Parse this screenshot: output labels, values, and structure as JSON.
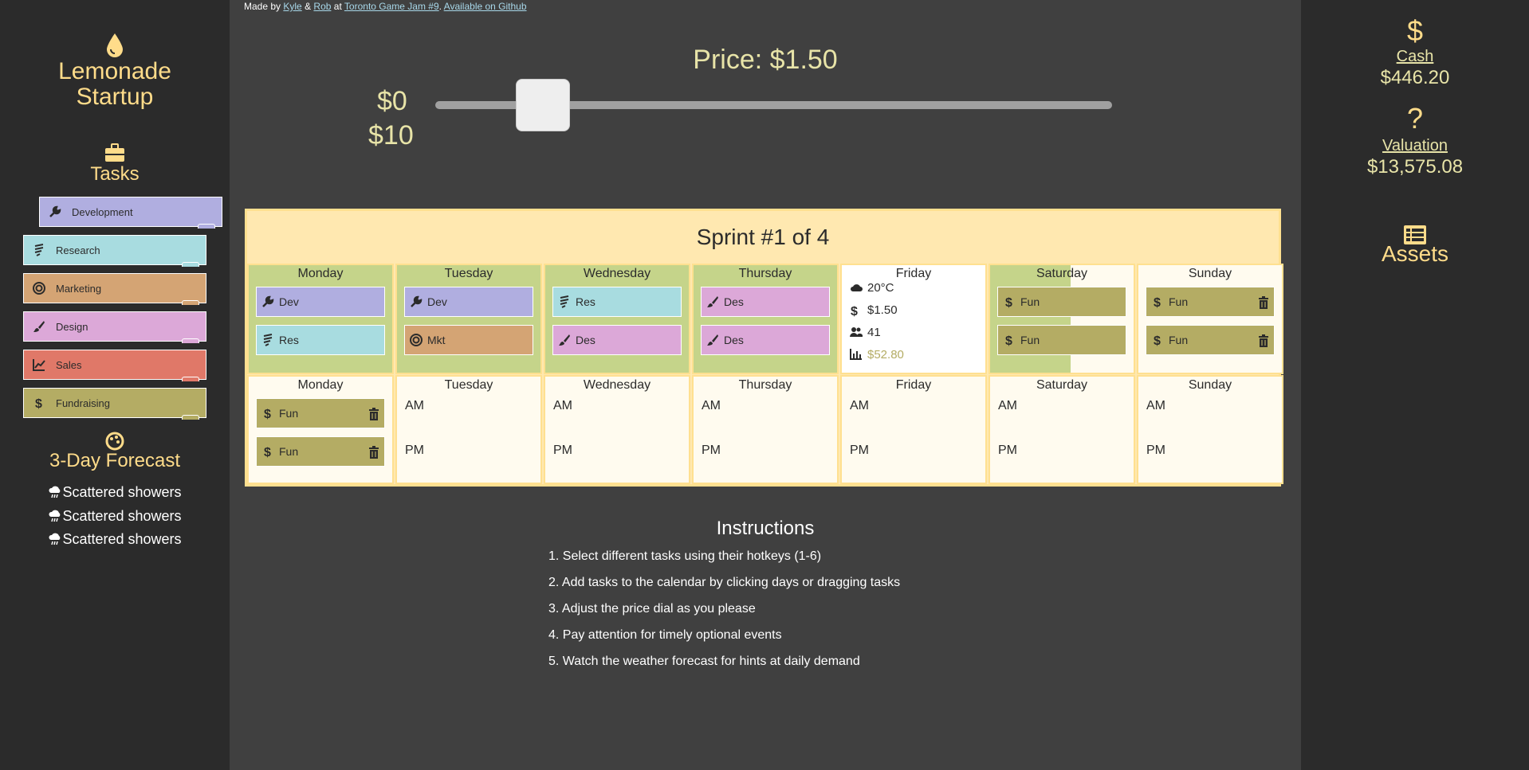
{
  "app": {
    "title_line1": "Lemonade",
    "title_line2": "Startup"
  },
  "credits": {
    "made_by": "Made by",
    "author1": "Kyle",
    "amp": "&",
    "author2": "Rob",
    "at": "at",
    "event": "Toronto Game Jam #9",
    "period": ".",
    "github": "Available on Github"
  },
  "tasks": {
    "title": "Tasks",
    "items": [
      {
        "label": "Development",
        "icon": "wrench-icon",
        "color": "#b0aee0"
      },
      {
        "label": "Research",
        "icon": "flask-icon",
        "color": "#a8dce0"
      },
      {
        "label": "Marketing",
        "icon": "target-icon",
        "color": "#d4a474"
      },
      {
        "label": "Design",
        "icon": "brush-icon",
        "color": "#dca8d8"
      },
      {
        "label": "Sales",
        "icon": "chart-line-icon",
        "color": "#e07868"
      },
      {
        "label": "Fundraising",
        "icon": "dollar-icon",
        "color": "#b4ac64"
      }
    ]
  },
  "forecast": {
    "title": "3-Day Forecast",
    "items": [
      "Scattered showers",
      "Scattered showers",
      "Scattered showers"
    ]
  },
  "price": {
    "label": "Price: $1.50",
    "min": "$0",
    "max": "$10",
    "value": 1.5,
    "range": [
      0,
      10
    ]
  },
  "sprint": {
    "title": "Sprint #1 of 4",
    "week1": [
      {
        "day": "Monday",
        "am": "Dev",
        "pm": "Res"
      },
      {
        "day": "Tuesday",
        "am": "Dev",
        "pm": "Mkt"
      },
      {
        "day": "Wednesday",
        "am": "Res",
        "pm": "Des"
      },
      {
        "day": "Thursday",
        "am": "Des",
        "pm": "Des"
      },
      {
        "day": "Friday",
        "temperature": "20°C",
        "price": "$1.50",
        "customers": "41",
        "revenue": "$52.80"
      },
      {
        "day": "Saturday",
        "am": "Fun",
        "pm": "Fun"
      },
      {
        "day": "Sunday",
        "am": "Fun",
        "pm": "Fun"
      }
    ],
    "week2": [
      {
        "day": "Monday",
        "am": "Fun",
        "pm": "Fun"
      },
      {
        "day": "Tuesday",
        "am": "AM",
        "pm": "PM"
      },
      {
        "day": "Wednesday",
        "am": "AM",
        "pm": "PM"
      },
      {
        "day": "Thursday",
        "am": "AM",
        "pm": "PM"
      },
      {
        "day": "Friday",
        "am": "AM",
        "pm": "PM"
      },
      {
        "day": "Saturday",
        "am": "AM",
        "pm": "PM"
      },
      {
        "day": "Sunday",
        "am": "AM",
        "pm": "PM"
      }
    ]
  },
  "instructions": {
    "title": "Instructions",
    "items": [
      "1. Select different tasks using their hotkeys (1-6)",
      "2. Add tasks to the calendar by clicking days or dragging tasks",
      "3. Adjust the price dial as you please",
      "4. Pay attention for timely optional events",
      "5. Watch the weather forecast for hints at daily demand"
    ]
  },
  "stats": {
    "cash_icon": "$",
    "cash_label": "Cash",
    "cash_value": "$446.20",
    "valuation_icon": "?",
    "valuation_label": "Valuation",
    "valuation_value": "$13,575.08",
    "assets_label": "Assets"
  }
}
